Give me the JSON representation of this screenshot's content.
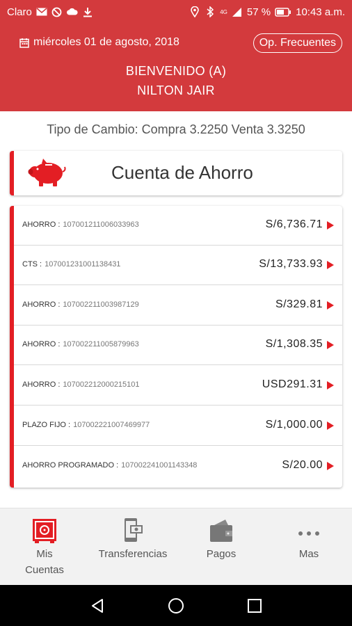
{
  "status_bar": {
    "carrier": "Claro",
    "signal_label": "4G",
    "battery": "57 %",
    "time": "10:43 a.m."
  },
  "header": {
    "date": "miércoles 01 de agosto, 2018",
    "frecuentes_label": "Op. Frecuentes",
    "welcome_line1": "BIENVENIDO (A)",
    "welcome_line2": "NILTON JAIR"
  },
  "exchange_rate": "Tipo de Cambio: Compra 3.2250 Venta 3.3250",
  "account_card": {
    "title": "Cuenta de Ahorro",
    "icon": "piggy-bank-icon"
  },
  "accounts": [
    {
      "type": "AHORRO :",
      "number": "107001211006033963",
      "amount": "S/6,736.71"
    },
    {
      "type": "CTS :",
      "number": "107001231001138431",
      "amount": "S/13,733.93"
    },
    {
      "type": "AHORRO :",
      "number": "107002211003987129",
      "amount": "S/329.81"
    },
    {
      "type": "AHORRO :",
      "number": "107002211005879963",
      "amount": "S/1,308.35"
    },
    {
      "type": "AHORRO :",
      "number": "107002212000215101",
      "amount": "USD291.31"
    },
    {
      "type": "PLAZO FIJO :",
      "number": "107002221007469977",
      "amount": "S/1,000.00"
    },
    {
      "type": "AHORRO PROGRAMADO :",
      "number": "107002241001143348",
      "amount": "S/20.00"
    }
  ],
  "bottom_nav": {
    "mis_cuentas_line1": "Mis",
    "mis_cuentas_line2": "Cuentas",
    "transferencias": "Transferencias",
    "pagos": "Pagos",
    "mas": "Mas"
  },
  "colors": {
    "brand_red": "#d33a3d",
    "accent_red": "#e31e24"
  }
}
